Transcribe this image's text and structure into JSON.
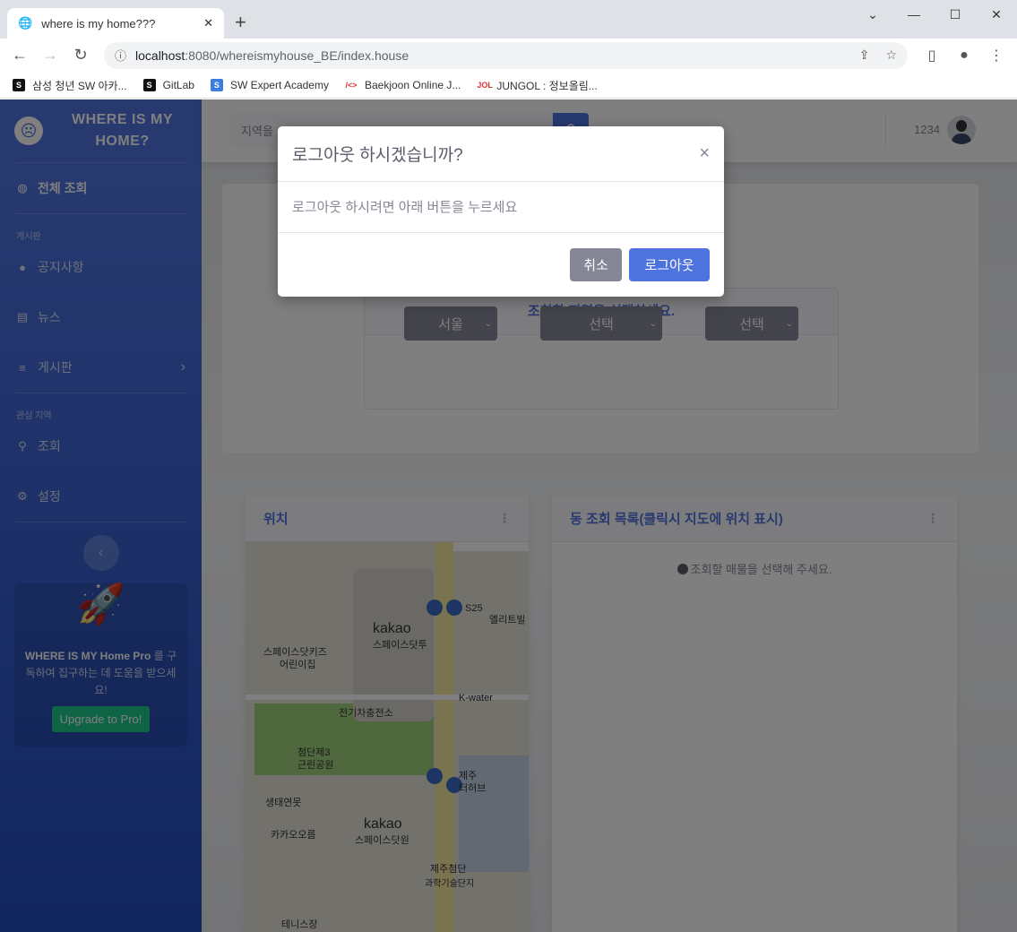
{
  "browser": {
    "tab_title": "where is my home???",
    "url_host": "localhost",
    "url_path": ":8080/whereismyhouse_BE/index.house",
    "bookmarks": [
      {
        "label": "삼성 청년 SW 아카...",
        "fav": "S",
        "color": "#111"
      },
      {
        "label": "GitLab",
        "fav": "S",
        "color": "#111"
      },
      {
        "label": "SW Expert Academy",
        "fav": "S",
        "color": "#3b7ddd"
      },
      {
        "label": "Baekjoon Online J...",
        "fav": "/<>",
        "color": "#fff"
      },
      {
        "label": "JUNGOL : 정보올림...",
        "fav": "JOL",
        "color": "#fff"
      }
    ]
  },
  "sidebar": {
    "brand": "WHERE IS MY HOME?",
    "active_item": "전체 조회",
    "heading_board": "게시판",
    "items_board": [
      "공지사항",
      "뉴스",
      "게시판"
    ],
    "heading_interest": "관심 지역",
    "items_interest": [
      "조회",
      "설정"
    ],
    "promo": {
      "bold": "WHERE IS MY Home Pro",
      "text": " 를 구독하여 집구하는 데 도움을 받으세요!",
      "button": "Upgrade to Pro!"
    }
  },
  "topbar": {
    "search_placeholder": "지역을",
    "username": "1234"
  },
  "selector": {
    "title": "조회할 지역을 선택하세요.",
    "selects": [
      "서울",
      "선택",
      "선택"
    ]
  },
  "location_card": {
    "title": "위치",
    "map_labels": [
      "kakao",
      "스페이스닷투",
      "스페이스닷키즈",
      "어린이집",
      "전기차충전소",
      "S25",
      "엘리트빌",
      "K-water",
      "첨단제3",
      "근린공원",
      "생태연못",
      "카카오오름",
      "kakao",
      "스페이스닷원",
      "제주",
      "터허브",
      "제주첨단",
      "과학기술단지",
      "테니스장"
    ]
  },
  "list_card": {
    "title": "동 조회 목록(클릭시 지도에 위치 표시)",
    "empty": "조회할 매물을 선택해 주세요."
  },
  "modal": {
    "title": "로그아웃 하시겠습니까?",
    "close": "×",
    "body": "로그아웃 하시려면 아래 버튼을 누르세요",
    "cancel": "취소",
    "confirm": "로그아웃"
  }
}
